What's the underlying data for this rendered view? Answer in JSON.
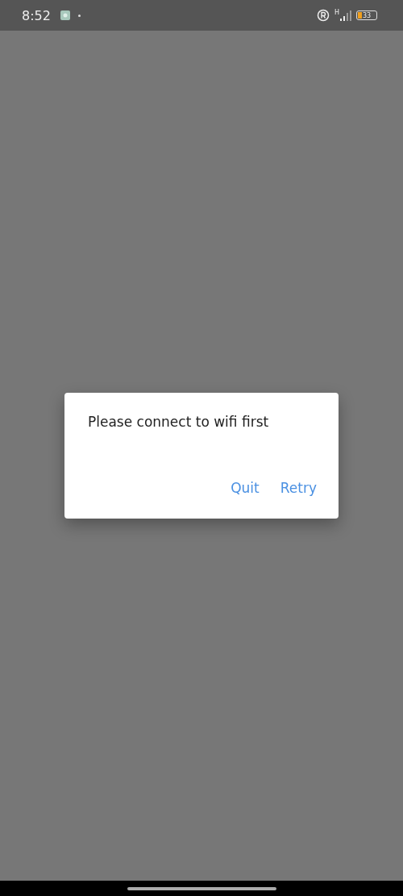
{
  "status_bar": {
    "time": "8:52",
    "network_type": "H",
    "battery": "33"
  },
  "dialog": {
    "message": "Please connect to wifi first",
    "buttons": [
      {
        "label": "Quit"
      },
      {
        "label": "Retry"
      }
    ]
  }
}
